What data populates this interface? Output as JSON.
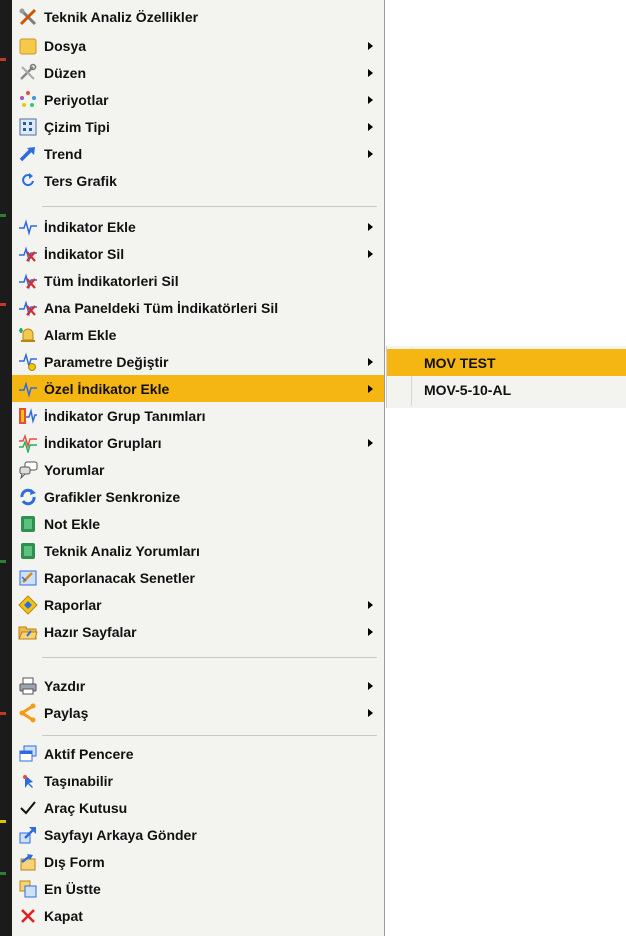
{
  "main_menu": {
    "items": [
      {
        "label": "Teknik Analiz Özellikler",
        "icon": "tools-cross-icon",
        "submenu": false
      },
      {
        "label": "Dosya",
        "icon": "folder-icon",
        "submenu": true
      },
      {
        "label": "Düzen",
        "icon": "tools-icon",
        "submenu": true
      },
      {
        "label": "Periyotlar",
        "icon": "periods-cycle-icon",
        "submenu": true
      },
      {
        "label": "Çizim Tipi",
        "icon": "chart-grid-icon",
        "submenu": true
      },
      {
        "label": "Trend",
        "icon": "trend-arrow-icon",
        "submenu": true
      },
      {
        "label": "Ters Grafik",
        "icon": "reverse-arrows-icon",
        "submenu": false
      },
      {
        "label": "İndikator Ekle",
        "icon": "indicator-add-icon",
        "submenu": true
      },
      {
        "label": "İndikator Sil",
        "icon": "indicator-delete-icon",
        "submenu": true
      },
      {
        "label": "Tüm İndikatorleri Sil",
        "icon": "indicator-delete-all-icon",
        "submenu": false
      },
      {
        "label": "Ana Paneldeki Tüm İndikatörleri Sil",
        "icon": "indicator-delete-panel-icon",
        "submenu": false
      },
      {
        "label": "Alarm Ekle",
        "icon": "alarm-bell-icon",
        "submenu": false
      },
      {
        "label": "Parametre Değiştir",
        "icon": "indicator-params-icon",
        "submenu": true
      },
      {
        "label": "Özel İndikator Ekle",
        "icon": "custom-indicator-icon",
        "submenu": true,
        "highlighted": true
      },
      {
        "label": "İndikator Grup Tanımları",
        "icon": "indicator-group-define-icon",
        "submenu": false
      },
      {
        "label": "İndikator Grupları",
        "icon": "indicator-groups-icon",
        "submenu": true
      },
      {
        "label": "Yorumlar",
        "icon": "comments-icon",
        "submenu": false
      },
      {
        "label": "Grafikler Senkronize",
        "icon": "sync-icon",
        "submenu": false
      },
      {
        "label": "Not Ekle",
        "icon": "note-icon",
        "submenu": false
      },
      {
        "label": "Teknik Analiz Yorumları",
        "icon": "analysis-note-icon",
        "submenu": false
      },
      {
        "label": "Raporlanacak Senetler",
        "icon": "report-edit-icon",
        "submenu": false
      },
      {
        "label": "Raporlar",
        "icon": "reports-icon",
        "submenu": true
      },
      {
        "label": "Hazır Sayfalar",
        "icon": "open-folder-icon",
        "submenu": true
      },
      {
        "label": "Yazdır",
        "icon": "printer-icon",
        "submenu": true
      },
      {
        "label": "Paylaş",
        "icon": "share-icon",
        "submenu": true
      },
      {
        "label": "Aktif Pencere",
        "icon": "window-icon",
        "submenu": false
      },
      {
        "label": "Taşınabilir",
        "icon": "movable-cursor-icon",
        "submenu": false
      },
      {
        "label": "Araç Kutusu",
        "icon": "checkmark-icon",
        "submenu": false,
        "checked": true
      },
      {
        "label": "Sayfayı Arkaya Gönder",
        "icon": "send-back-icon",
        "submenu": false
      },
      {
        "label": "Dış Form",
        "icon": "external-form-icon",
        "submenu": false
      },
      {
        "label": "En Üstte",
        "icon": "on-top-icon",
        "submenu": false
      },
      {
        "label": "Kapat",
        "icon": "close-icon",
        "submenu": false
      }
    ]
  },
  "submenu": {
    "items": [
      {
        "label": "MOV TEST",
        "highlighted": true
      },
      {
        "label": "MOV-5-10-AL"
      }
    ]
  },
  "colors": {
    "highlight": "#f5b512",
    "menu_background": "#f3f3f0",
    "separator": "#c8c8c8"
  }
}
